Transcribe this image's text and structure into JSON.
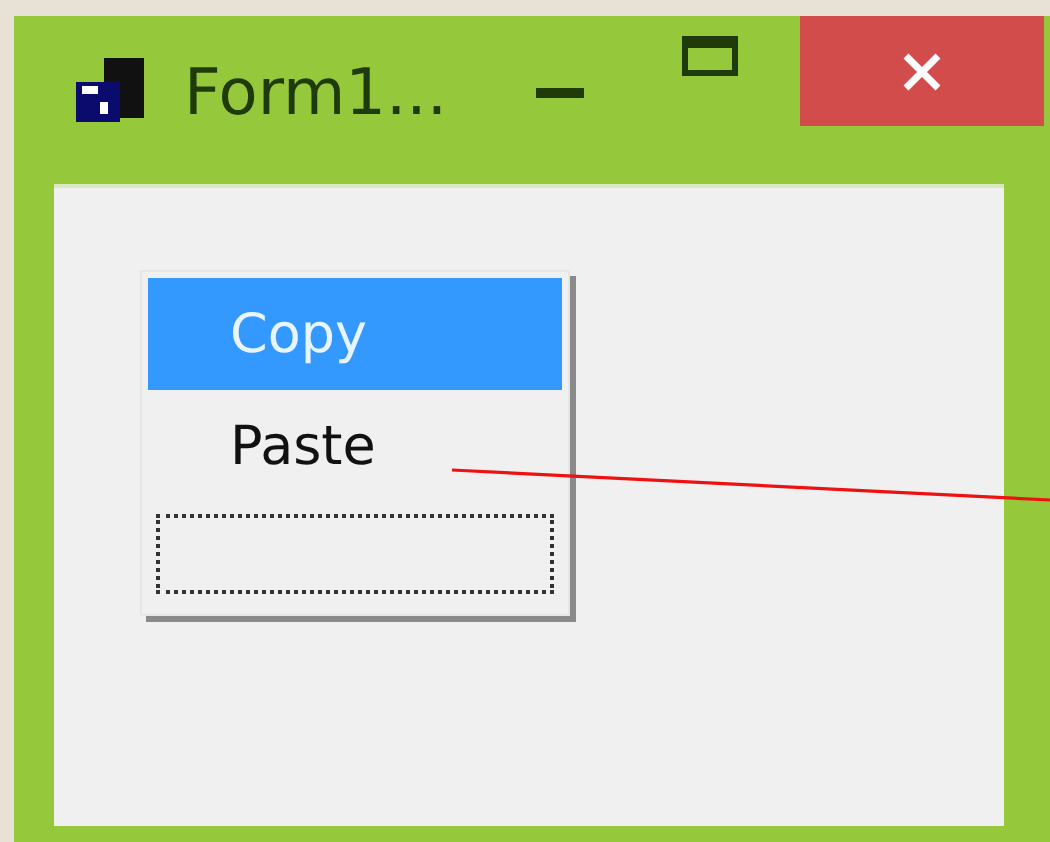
{
  "window": {
    "title": "Form1..."
  },
  "context_menu": {
    "items": [
      {
        "kind": "text",
        "label": "Copy",
        "selected": true,
        "focused": false
      },
      {
        "kind": "text",
        "label": "Paste",
        "selected": false,
        "focused": false
      },
      {
        "kind": "blank",
        "selected": false,
        "focused": true
      }
    ]
  }
}
